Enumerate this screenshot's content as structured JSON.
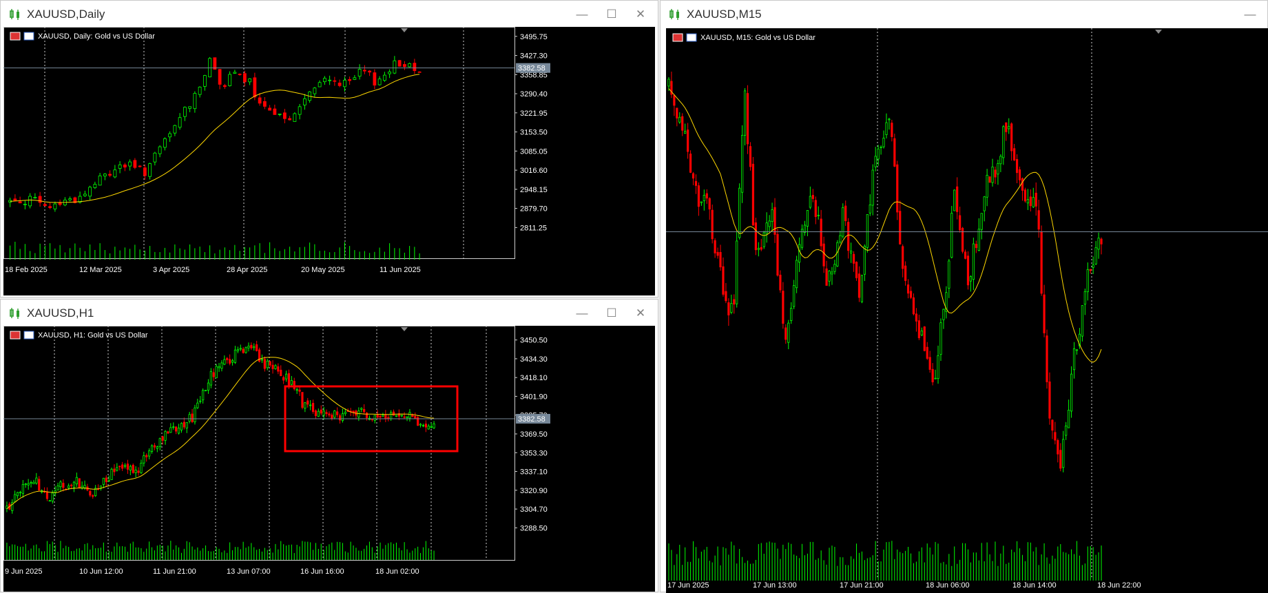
{
  "windows": [
    {
      "id": "daily",
      "title": "XAUUSD,Daily"
    },
    {
      "id": "h1",
      "title": "XAUUSD,H1"
    },
    {
      "id": "m15",
      "title": "XAUUSD,M15"
    }
  ],
  "window_buttons": {
    "minimize": "—",
    "maximize": "☐",
    "close": "✕"
  },
  "colors": {
    "bull": "#00ff00",
    "bear": "#ff0000",
    "ma": "#ffd800",
    "grid": "#cfcfcf",
    "axis_text": "#ffffff",
    "price_line": "#778899",
    "highlight": "#ff0000",
    "background": "#000000"
  },
  "chart_data": [
    {
      "id": "daily",
      "type": "candlestick",
      "header": "XAUUSD, Daily:  Gold vs US Dollar",
      "current_price": "3382.58",
      "yticks": [
        "3495.75",
        "3427.30",
        "3358.85",
        "3290.40",
        "3221.95",
        "3153.50",
        "3085.05",
        "3016.60",
        "2948.15",
        "2879.70",
        "2811.25"
      ],
      "xticks": [
        "18 Feb 2025",
        "12 Mar 2025",
        "3 Apr 2025",
        "28 Apr 2025",
        "20 May 2025",
        "11 Jun 2025"
      ],
      "ylim": [
        2790,
        3510
      ],
      "bars": 83,
      "ma_period": 20,
      "anchors": [
        [
          0,
          2905
        ],
        [
          6,
          2915
        ],
        [
          10,
          2880
        ],
        [
          15,
          2905
        ],
        [
          20,
          2920
        ],
        [
          25,
          2980
        ],
        [
          32,
          3040
        ],
        [
          38,
          3010
        ],
        [
          42,
          3080
        ],
        [
          47,
          3180
        ],
        [
          52,
          3280
        ],
        [
          57,
          3410
        ],
        [
          60,
          3320
        ],
        [
          64,
          3360
        ],
        [
          68,
          3330
        ],
        [
          70,
          3250
        ],
        [
          73,
          3220
        ],
        [
          76,
          3240
        ],
        [
          79,
          3180
        ],
        [
          82,
          3250
        ],
        [
          85,
          3290
        ],
        [
          90,
          3350
        ],
        [
          95,
          3320
        ],
        [
          100,
          3370
        ],
        [
          104,
          3330
        ],
        [
          108,
          3390
        ],
        [
          112,
          3400
        ],
        [
          116,
          3382
        ]
      ]
    },
    {
      "id": "h1",
      "type": "candlestick",
      "header": "XAUUSD, H1:  Gold vs US Dollar",
      "current_price": "3382.58",
      "yticks": [
        "3450.50",
        "3434.30",
        "3418.10",
        "3401.90",
        "3385.70",
        "3369.50",
        "3353.30",
        "3337.10",
        "3320.90",
        "3304.70",
        "3288.50"
      ],
      "xticks": [
        "9 Jun 2025",
        "10 Jun 12:00",
        "11 Jun 21:00",
        "13 Jun 07:00",
        "16 Jun 16:00",
        "18 Jun 02:00"
      ],
      "ylim": [
        3281,
        3458
      ],
      "bars": 160,
      "ma_period": 20,
      "anchors": [
        [
          0,
          3305
        ],
        [
          6,
          3322
        ],
        [
          14,
          3328
        ],
        [
          20,
          3312
        ],
        [
          26,
          3324
        ],
        [
          34,
          3328
        ],
        [
          42,
          3318
        ],
        [
          48,
          3330
        ],
        [
          54,
          3343
        ],
        [
          62,
          3335
        ],
        [
          68,
          3355
        ],
        [
          76,
          3368
        ],
        [
          84,
          3375
        ],
        [
          90,
          3385
        ],
        [
          98,
          3420
        ],
        [
          106,
          3432
        ],
        [
          112,
          3440
        ],
        [
          118,
          3445
        ],
        [
          124,
          3430
        ],
        [
          130,
          3425
        ],
        [
          136,
          3415
        ],
        [
          140,
          3410
        ],
        [
          142,
          3397
        ],
        [
          150,
          3386
        ],
        [
          160,
          3385
        ],
        [
          170,
          3389
        ],
        [
          180,
          3384
        ],
        [
          190,
          3388
        ],
        [
          196,
          3384
        ],
        [
          202,
          3374
        ],
        [
          206,
          3382
        ]
      ]
    },
    {
      "id": "m15",
      "type": "candlestick",
      "header": "XAUUSD, M15:  Gold vs US Dollar",
      "current_price": "3382.58",
      "yticks": [],
      "xticks": [
        "17 Jun 2025",
        "17 Jun 13:00",
        "17 Jun 21:00",
        "18 Jun 06:00",
        "18 Jun 14:00",
        "18 Jun 22:00"
      ],
      "ylim": [
        3362,
        3400
      ],
      "bars": 160,
      "ma_period": 20,
      "anchors": [
        [
          0,
          3395
        ],
        [
          8,
          3392
        ],
        [
          14,
          3386
        ],
        [
          20,
          3385
        ],
        [
          28,
          3378
        ],
        [
          34,
          3375
        ],
        [
          40,
          3395
        ],
        [
          46,
          3380
        ],
        [
          54,
          3385
        ],
        [
          62,
          3372
        ],
        [
          68,
          3382
        ],
        [
          76,
          3386
        ],
        [
          84,
          3378
        ],
        [
          92,
          3384
        ],
        [
          100,
          3377
        ],
        [
          108,
          3388
        ],
        [
          116,
          3393
        ],
        [
          124,
          3378
        ],
        [
          132,
          3374
        ],
        [
          140,
          3370
        ],
        [
          146,
          3377
        ],
        [
          150,
          3386
        ],
        [
          158,
          3378
        ],
        [
          166,
          3386
        ],
        [
          172,
          3388
        ],
        [
          178,
          3392
        ],
        [
          186,
          3386
        ],
        [
          194,
          3385
        ],
        [
          200,
          3368
        ],
        [
          206,
          3362
        ],
        [
          214,
          3372
        ],
        [
          222,
          3380
        ],
        [
          228,
          3382
        ]
      ]
    }
  ]
}
